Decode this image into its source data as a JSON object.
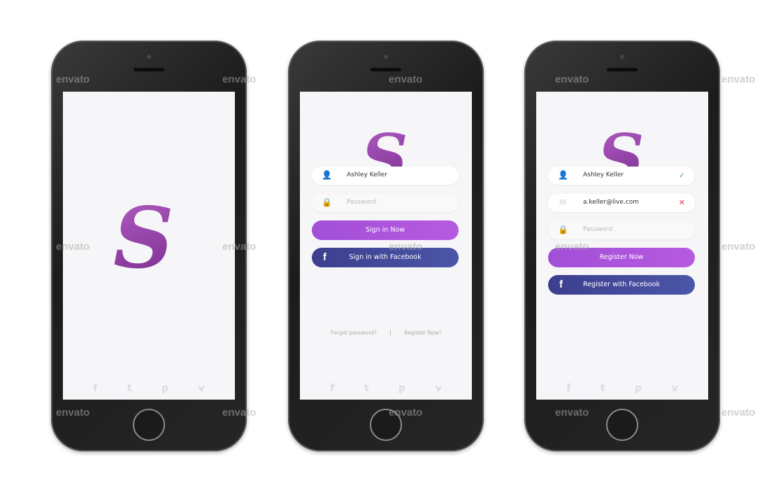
{
  "watermark": "envato",
  "colors": {
    "primary": "#a24fd8",
    "facebook": "#3d3e8f",
    "logo": "#8b3aa0",
    "success": "#4caf50",
    "error": "#e0344a"
  },
  "splash": {
    "logo_letter": "S"
  },
  "login": {
    "logo_letter": "S",
    "username": {
      "value": "Ashley Keller",
      "icon": "user-icon"
    },
    "password": {
      "placeholder": "Password",
      "icon": "lock-icon"
    },
    "sign_in_label": "Sign in Now",
    "facebook_label": "Sign in with Facebook",
    "forgot_label": "Forgot password?",
    "separator": "|",
    "register_link": "Register Now!"
  },
  "register": {
    "logo_letter": "S",
    "name": {
      "value": "Ashley Keller",
      "status": "✓"
    },
    "email": {
      "value": "a.keller@live.com",
      "status": "✕"
    },
    "password": {
      "placeholder": "Password"
    },
    "register_label": "Register Now",
    "facebook_label": "Register with Facebook"
  },
  "social_icons": [
    "facebook-icon",
    "twitter-icon",
    "pinterest-icon",
    "vimeo-icon"
  ],
  "social_glyphs": {
    "facebook": "f",
    "twitter": "t",
    "pinterest": "p",
    "vimeo": "v"
  },
  "fb_glyph": "f"
}
